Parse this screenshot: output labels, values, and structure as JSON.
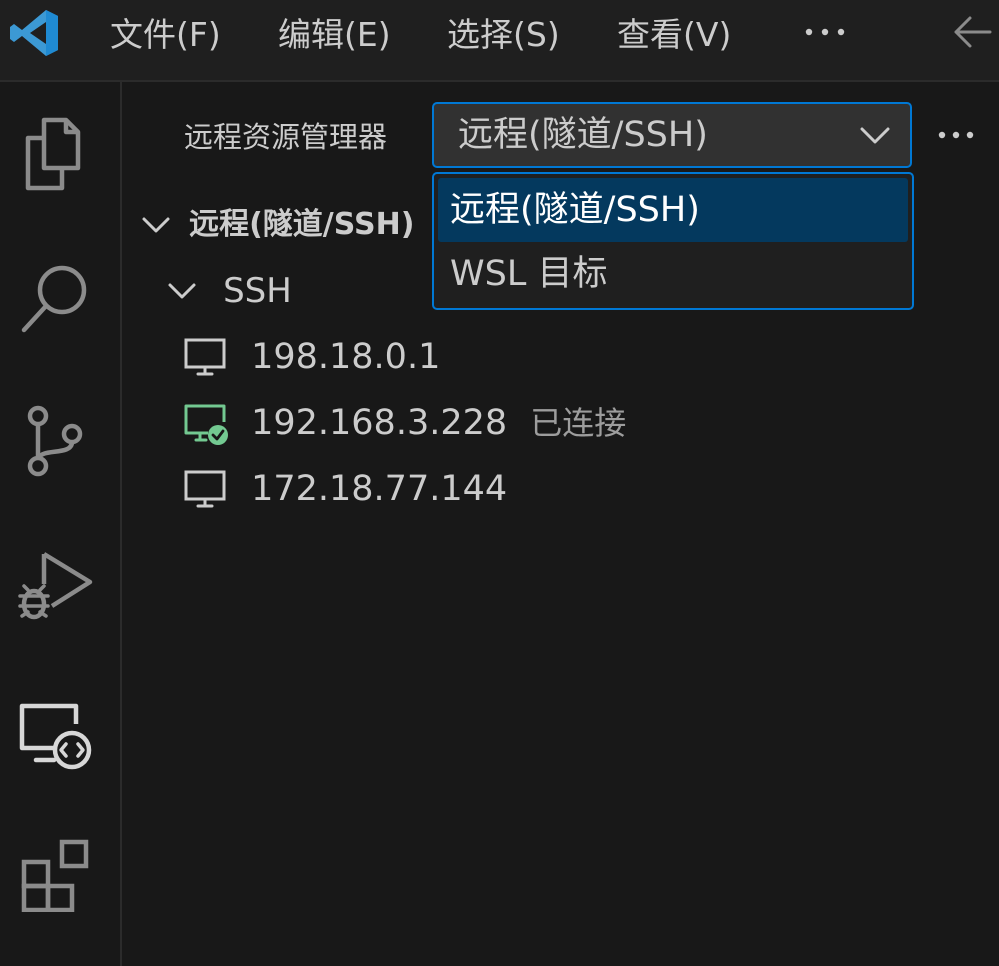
{
  "titlebar": {
    "menu": [
      {
        "label": "文件(F)"
      },
      {
        "label": "编辑(E)"
      },
      {
        "label": "选择(S)"
      },
      {
        "label": "查看(V)"
      }
    ],
    "more_icon": "ellipsis-icon",
    "back_icon": "arrow-left-icon"
  },
  "activitybar": {
    "items": [
      {
        "icon": "explorer-files-icon"
      },
      {
        "icon": "search-icon"
      },
      {
        "icon": "source-control-icon"
      },
      {
        "icon": "run-debug-icon"
      },
      {
        "icon": "remote-explorer-icon",
        "active": true
      },
      {
        "icon": "extensions-icon"
      }
    ]
  },
  "sidebar": {
    "title": "远程资源管理器",
    "select": {
      "value": "远程(隧道/SSH)",
      "options": [
        "远程(隧道/SSH)",
        "WSL 目标"
      ],
      "selected_index": 0
    },
    "section": {
      "title": "远程(隧道/SSH)",
      "group": "SSH",
      "hosts": [
        {
          "label": "198.18.0.1",
          "status": ""
        },
        {
          "label": "192.168.3.228",
          "status": "已连接"
        },
        {
          "label": "172.18.77.144",
          "status": ""
        }
      ]
    }
  },
  "colors": {
    "accent": "#0078d4",
    "connected": "#73c991",
    "selected_bg": "#04395e",
    "logo": "#3c99d4"
  }
}
